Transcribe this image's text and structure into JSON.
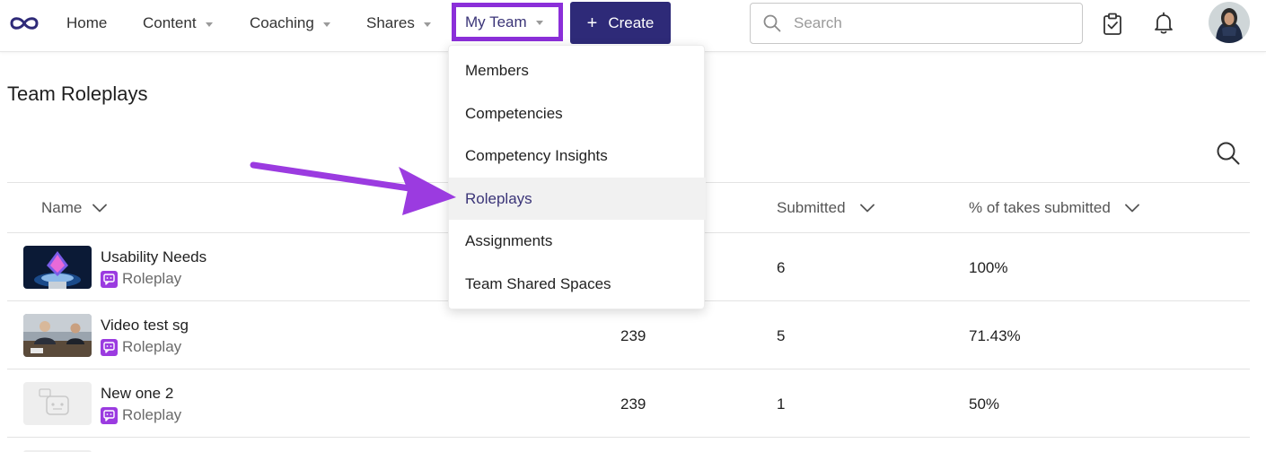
{
  "nav": {
    "home": "Home",
    "content": "Content",
    "coaching": "Coaching",
    "shares": "Shares",
    "my_team": "My Team",
    "create": "Create",
    "create_plus": "+",
    "search_placeholder": "Search"
  },
  "page": {
    "title": "Team Roleplays"
  },
  "table": {
    "headers": {
      "name": "Name",
      "submitted": "Submitted",
      "pct": "% of takes submitted"
    },
    "rows": [
      {
        "title": "Usability Needs",
        "type": "Roleplay",
        "col_mid": "",
        "submitted": "6",
        "pct": "100%"
      },
      {
        "title": "Video test sg",
        "type": "Roleplay",
        "col_mid": "239",
        "submitted": "5",
        "pct": "71.43%"
      },
      {
        "title": "New one 2",
        "type": "Roleplay",
        "col_mid": "239",
        "submitted": "1",
        "pct": "50%"
      }
    ]
  },
  "dropdown": {
    "items": [
      "Members",
      "Competencies",
      "Competency Insights",
      "Roleplays",
      "Assignments",
      "Team Shared Spaces"
    ],
    "active_index": 3
  },
  "colors": {
    "brand_dark": "#2e2a78",
    "highlight_purple": "#8b2fd9",
    "roleplay_badge": "#9b3be0"
  },
  "icons": [
    "infinity-logo-icon",
    "search-icon",
    "clipboard-check-icon",
    "bell-icon",
    "chevron-down-icon",
    "roleplay-chat-icon",
    "arrow-pointer-icon"
  ]
}
